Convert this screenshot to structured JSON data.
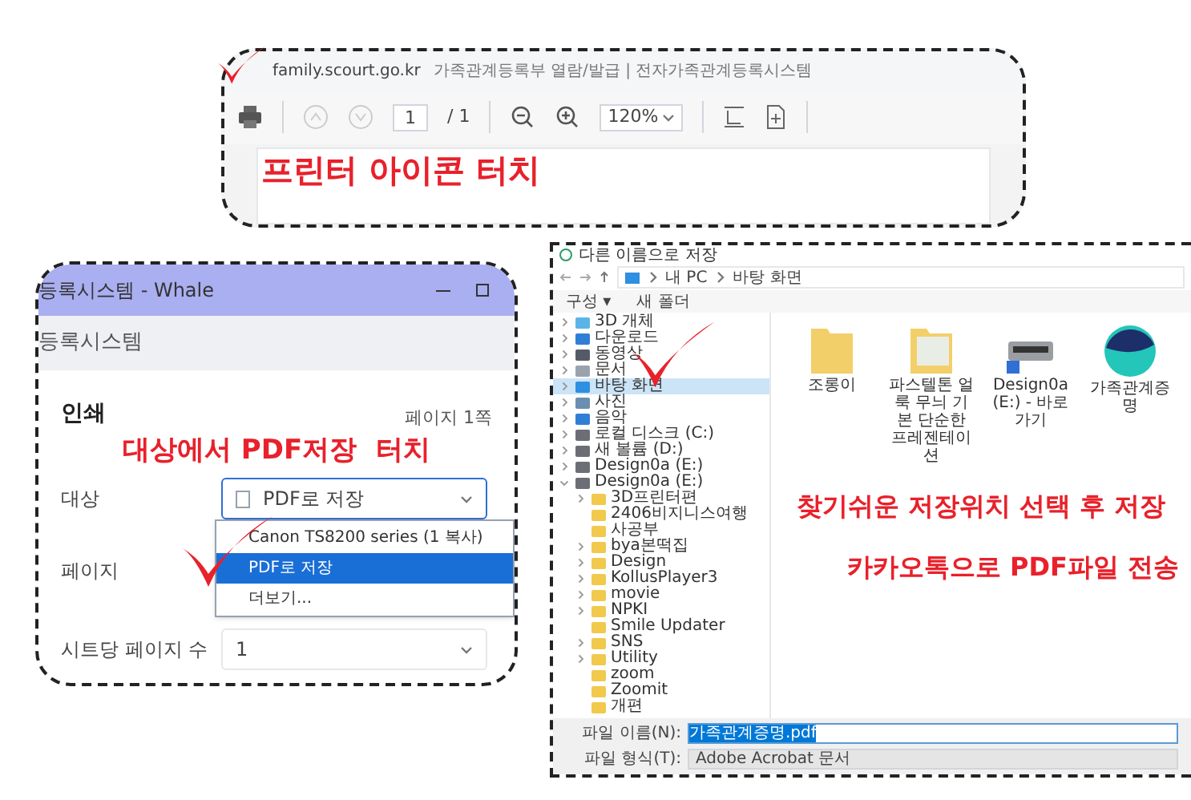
{
  "print_toolbar_panel": {
    "address": "family.scourt.go.kr",
    "page_title": "가족관계등록부 열람/발급 | 전자가족관계등록시스템",
    "page_input": "1",
    "page_total": "/ 1",
    "zoom": "120%",
    "annotation": "프린터 아이콘 터치"
  },
  "print_dialog_panel": {
    "window_title": "등록시스템 - Whale",
    "tab_title": "등록시스템",
    "heading": "인쇄",
    "page_count": "페이지 1쪽",
    "annotation": "대상에서 PDF저장  터치",
    "fields": [
      {
        "label": "대상",
        "value": "PDF로 저장"
      },
      {
        "label": "페이지"
      },
      {
        "label": "시트당 페이지 수",
        "value": "1"
      }
    ],
    "destination_menu": [
      {
        "label": "Canon TS8200 series (1 복사)",
        "selected": false
      },
      {
        "label": "PDF로 저장",
        "selected": true
      },
      {
        "label": "더보기...",
        "selected": false
      }
    ]
  },
  "save_dialog_panel": {
    "title": "다른 이름으로 저장",
    "breadcrumb": [
      "내 PC",
      "바탕 화면"
    ],
    "toolbar": [
      "구성 ▾",
      "새 폴더"
    ],
    "tree": [
      {
        "label": "3D 개체",
        "kind": "object",
        "selected": false
      },
      {
        "label": "다운로드",
        "kind": "download",
        "selected": false
      },
      {
        "label": "동영상",
        "kind": "video",
        "selected": false
      },
      {
        "label": "문서",
        "kind": "document",
        "selected": false
      },
      {
        "label": "바탕 화면",
        "kind": "desktop",
        "selected": true
      },
      {
        "label": "사진",
        "kind": "picture",
        "selected": false
      },
      {
        "label": "음악",
        "kind": "music",
        "selected": false
      },
      {
        "label": "로컬 디스크 (C:)",
        "kind": "drive",
        "selected": false
      },
      {
        "label": "새 볼륨 (D:)",
        "kind": "drive",
        "selected": false
      },
      {
        "label": "Design0a (E:)",
        "kind": "drive",
        "selected": false
      },
      {
        "label": "Design0a (E:)",
        "kind": "drive",
        "selected": false,
        "expanded": true,
        "children": [
          {
            "label": "3D프린터편",
            "kind": "folder",
            "selected": false,
            "expandable": true
          },
          {
            "label": "2406비지니스여행",
            "kind": "folder",
            "selected": false,
            "expandable": false
          },
          {
            "label": "사공부",
            "kind": "folder",
            "selected": false,
            "expandable": false
          },
          {
            "label": "bya본떡집",
            "kind": "folder",
            "selected": false,
            "expandable": true
          },
          {
            "label": "Design",
            "kind": "folder",
            "selected": false,
            "expandable": true
          },
          {
            "label": "KollusPlayer3",
            "kind": "folder",
            "selected": false,
            "expandable": true
          },
          {
            "label": "movie",
            "kind": "folder",
            "selected": false,
            "expandable": true
          },
          {
            "label": "NPKI",
            "kind": "folder",
            "selected": false,
            "expandable": true
          },
          {
            "label": "Smile Updater",
            "kind": "folder",
            "selected": false,
            "expandable": false
          },
          {
            "label": "SNS",
            "kind": "folder",
            "selected": false,
            "expandable": true
          },
          {
            "label": "Utility",
            "kind": "folder",
            "selected": false,
            "expandable": true
          },
          {
            "label": "zoom",
            "kind": "folder",
            "selected": false,
            "expandable": false
          },
          {
            "label": "Zoomit",
            "kind": "folder",
            "selected": false,
            "expandable": false
          },
          {
            "label": "개편",
            "kind": "folder",
            "selected": false,
            "expandable": false
          }
        ]
      }
    ],
    "files": [
      {
        "label": "조롱이",
        "kind": "folder"
      },
      {
        "label": "파스텔톤 얼룩 무늬 기본 단순한 프레젠테이션",
        "kind": "preview-folder"
      },
      {
        "label": "Design0a (E:) - 바로 가기",
        "kind": "drive"
      },
      {
        "label": "가족관계증명",
        "kind": "whale"
      }
    ],
    "annotations": [
      "찾기쉬운 저장위치 선택 후 저장",
      "카카오톡으로 PDF파일 전송"
    ],
    "file_name_label": "파일 이름(N):",
    "file_name": "가족관계증명.pdf",
    "file_type_label": "파일 형식(T):",
    "file_type": "Adobe Acrobat 문서"
  }
}
